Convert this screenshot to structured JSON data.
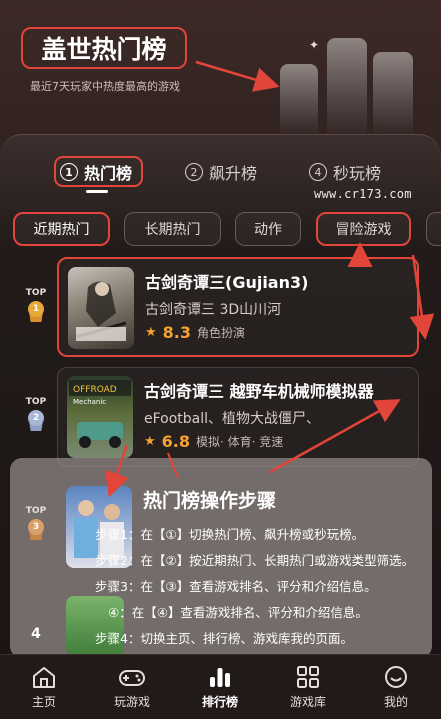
{
  "header": {
    "title": "盖世热门榜",
    "subtitle": "最近7天玩家中热度最高的游戏"
  },
  "tabs": [
    {
      "num": "1",
      "label": "热门榜",
      "active": true
    },
    {
      "num": "2",
      "label": "飙升榜",
      "active": false
    },
    {
      "num": "4",
      "label": "秒玩榜",
      "active": false
    }
  ],
  "watermark": "www.cr173.com",
  "chips": [
    "近期热门",
    "长期热门",
    "动作",
    "冒险游戏"
  ],
  "games": [
    {
      "rank_label": "TOP",
      "rank": "1",
      "title": "古剑奇谭三(Gujian3)",
      "desc": "古剑奇谭三 3D山川河",
      "score": "8.3",
      "tags": "角色扮演"
    },
    {
      "rank_label": "TOP",
      "rank": "2",
      "title": "古剑奇谭三 越野车机械师模拟器",
      "desc": "eFootball、植物大战僵尸、",
      "score": "6.8",
      "tags": "模拟· 体育· 竞速"
    },
    {
      "rank_label": "TOP",
      "rank": "3"
    },
    {
      "rank": "4"
    }
  ],
  "guide": {
    "title": "热门榜操作步骤",
    "steps": [
      "步骤1：在【①】切换热门榜、飙升榜或秒玩榜。",
      "步骤2：在【②】按近期热门、长期热门或游戏类型筛选。",
      "步骤3：在【③】查看游戏排名、评分和介绍信息。",
      "④：在【④】查看游戏排名、评分和介绍信息。",
      "步骤4：切换主页、排行榜、游戏库我的页面。"
    ]
  },
  "nav": [
    {
      "label": "主页",
      "icon": "home-icon",
      "active": false
    },
    {
      "label": "玩游戏",
      "icon": "gamepad-icon",
      "active": false
    },
    {
      "label": "排行榜",
      "icon": "ranking-icon",
      "active": true
    },
    {
      "label": "游戏库",
      "icon": "grid-icon",
      "active": false
    },
    {
      "label": "我的",
      "icon": "smile-icon",
      "active": false
    }
  ],
  "colors": {
    "accent": "#e2453a",
    "score": "#f4a233",
    "background": "#2a1d1b"
  }
}
